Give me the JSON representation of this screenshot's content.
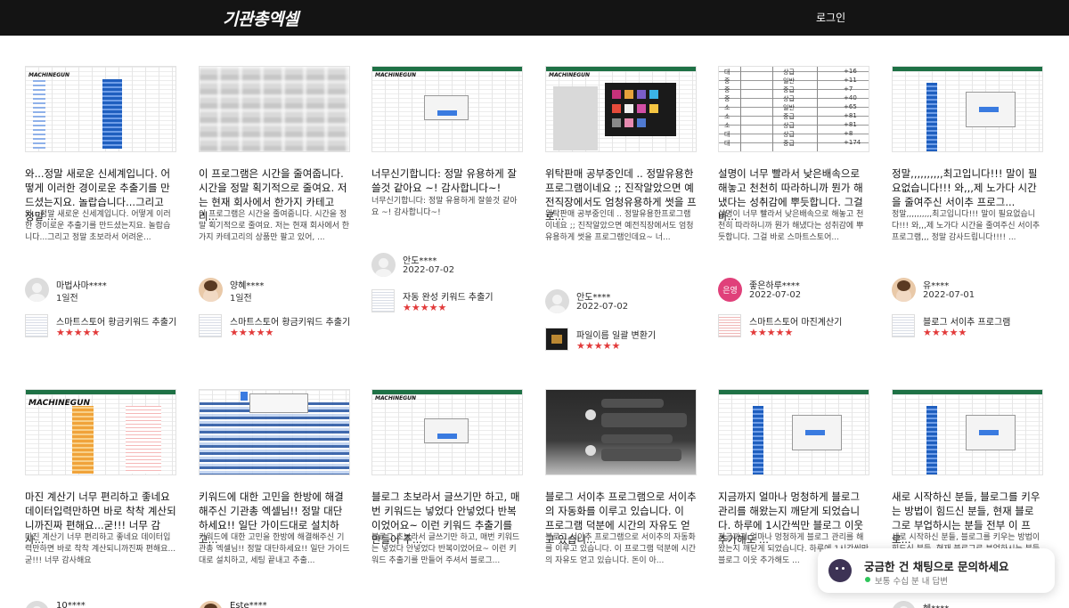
{
  "header": {
    "logo": "기관총엑셀",
    "login": "로그인"
  },
  "colors": {
    "topbar": "#141414",
    "stars": "#e23a3a",
    "excel_green": "#1e7145"
  },
  "reviews": [
    {
      "title": "와...정말 새로운 신세계입니다. 어떻게 이러한 경이로운 추출기를 만드셨는지요. 놀랍습니다...그리고 정말 ...",
      "body": "와...정말 새로운 신세계입니다. 어떻게 이러한 경이로운 추출기를 만드셨는지요. 놀랍습니다...그리고 정말 초보라서 어려운...",
      "author": "마법사마****",
      "date": "1일전",
      "product": "스마트스토어 황금키워드 추출기",
      "stars": "★★★★★"
    },
    {
      "title": "이 프로그램은 시간을 줄여줍니다. 시간을 정말 획기적으로 줄여요. 저는 현재 회사에서 한가지 카테고리...",
      "body": "이 프로그램은 시간을 줄여줍니다. 시간을 정말 획기적으로 줄여요. 저는 현재 회사에서 한가지 카테고리의 상품만 팔고 있어, ...",
      "author": "양혜****",
      "date": "1일전",
      "product": "스마트스토어 황금키워드 추출기",
      "stars": "★★★★★"
    },
    {
      "title": "너무신기합니다: 정말 유용하게 잘쓸것 같아요 ~! 감사합니다~!",
      "body": "너무신기합니다: 정말 유용하게 잘쓸것 같아요 ~! 감사합니다~!",
      "author": "안도****",
      "date": "2022-07-02",
      "product": "자동 완성 키워드 추출기",
      "stars": "★★★★★"
    },
    {
      "title": "위탁판매 공부중인데 .. 정말유용한 프로그램이네요 ;; 진작알았으면 예전직장에서도 엄청유용하게 썻을 프로...",
      "body": "위탁판매 공부중인데 .. 정말유용한프로그램이네요 ;; 진작알았으면 예전직장에서도 엄청유용하게 썻을 프로그램인데요~ 너...",
      "author": "안도****",
      "date": "2022-07-02",
      "product": "파일이름 일괄 변환기",
      "stars": "★★★★★"
    },
    {
      "title": "설명이 너무 빨라서 낮은배속으로 해놓고 천천히 따라하니까 뭔가 해냈다는 성취감에 뿌듯합니다. 그걸 바...",
      "body": "설명이 너무 빨라서 낮은배속으로 해놓고 천천히 따라하니까 뭔가 해냈다는 성취감에 뿌듯합니다. 그걸 바로 스마트스토어...",
      "author": "좋은하루****",
      "avatar_text": "은영",
      "date": "2022-07-02",
      "product": "스마트스토어 마진계산기",
      "stars": "★★★★★"
    },
    {
      "title": "정말,,,,,,,,,,최고입니다!!! 말이 필요없습니다!!! 와,,,제 노가다 시간을 줄여주신 서이추 프로그...",
      "body": "정말,,,,,,,,,,최고입니다!!! 말이 필요없습니다!!! 와,,,제 노가다 시간을 줄여주신 서이추 프로그램,,, 정말 감사드립니다!!!! ...",
      "author": "유****",
      "date": "2022-07-01",
      "product": "블로그 서이추 프로그램",
      "stars": "★★★★★"
    },
    {
      "title": "마진 계산기 너무 편리하고 좋네요 데이터입력만하면 바로 착착 계산되니까진짜 편해요...굳!!! 너무 감사...",
      "body": "마진 계산기 너무 편리하고 좋네요 데이터입력만하면 바로 착착 계산되니까진짜 편해요...굳!!! 너무 감사해요",
      "author": "10****"
    },
    {
      "title": "키워드에 대한 고민을 한방에 해결해주신 기관총 엑셀님!! 정말 대단하세요!! 일단 가이드대로 설치하고...",
      "body": "키워드에 대한 고민을 한방에 해결해주신 기관총 엑셀님!! 정말 대단하세요!! 일단 가이드대로 설치하고, 세팅 끝내고 추출...",
      "author": "Este****"
    },
    {
      "title": "블로그 초보라서 글쓰기만 하고, 매번 키워드는 넣었다 안넣었다 반복이었어요~ 이런 키워드 추출기를 만들어 주...",
      "body": "블로그 초보라서 글쓰기만 하고, 매번 키워드는 넣었다 안넣었다 반복이었어요~ 이런 키워드 추출기를 만들어 주셔서 블로그..."
    },
    {
      "title": "블로그 서이추 프로그램으로 서이추의 자동화를 이루고 있습니다. 이 프로그램 덕분에 시간의 자유도 얻고 있습니...",
      "body": "블로그 서이추 프로그램으로 서이추의 자동화를 이루고 있습니다. 이 프로그램 덕분에 시간의 자유도 얻고 있습니다. 돈이 아..."
    },
    {
      "title": "지금까지 얼마나 멍청하게 블로그 관리를 해왔는지 깨닫게 되었습니다. 하루에 1시간씩만 블로그 이웃 추가해도 ...",
      "body": "지금까지 얼마나 멍청하게 블로그 관리를 해왔는지 깨닫게 되었습니다. 하루에 1시간씩만 블로그 이웃 추가해도 ..."
    },
    {
      "title": "새로 시작하신 분들, 블로그를 키우는 방법이 힘드신 분들, 현재 블로그로 부업하시는 분들 전부 이 프로...",
      "body": "새로 시작하신 분들, 블로그를 키우는 방법이 힘드신 분들, 현재 블로그로 부업하시는 분들 전부 이 프로그램...",
      "author": "혜****"
    }
  ],
  "thumb_text": {
    "machinegun": "MACHINEGUN",
    "table_rows": [
      [
        "대",
        "상급",
        "+16"
      ],
      [
        "중",
        "일반",
        "+11"
      ],
      [
        "중",
        "중급",
        "+7"
      ],
      [
        "중",
        "상급",
        "+40"
      ],
      [
        "소",
        "일반",
        "+65"
      ],
      [
        "소",
        "중급",
        "+81"
      ],
      [
        "소",
        "상급",
        "+81"
      ],
      [
        "대",
        "상급",
        "+8"
      ],
      [
        "대",
        "중급",
        "+174"
      ]
    ]
  },
  "chat_widget": {
    "title": "궁금한 건 채팅으로 문의하세요",
    "subtitle": "보통 수십 분 내 답변"
  }
}
